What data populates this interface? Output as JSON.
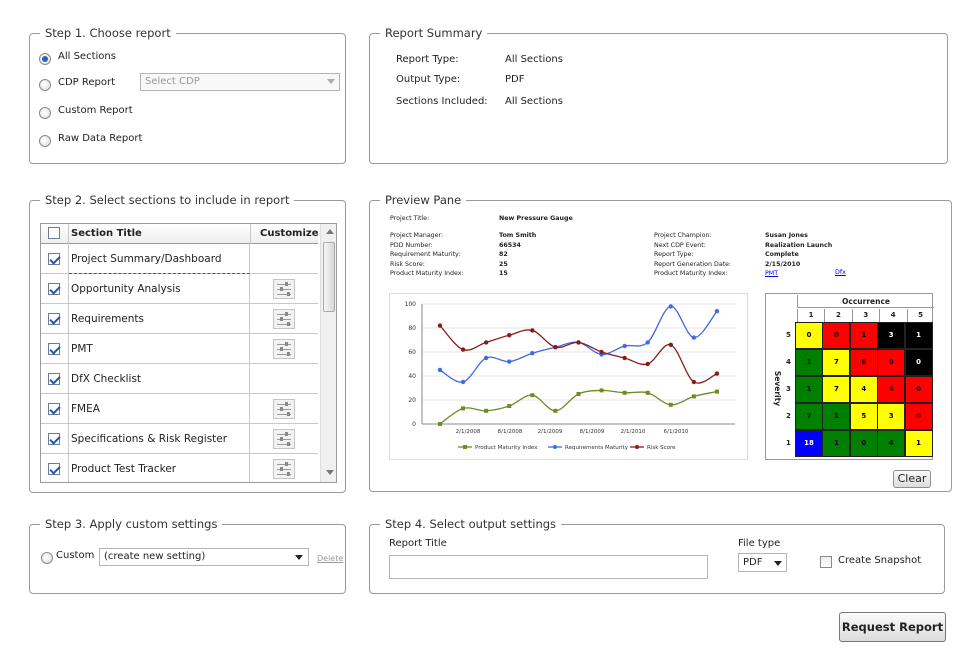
{
  "step1": {
    "legend": "Step 1. Choose report",
    "options": [
      {
        "label": "All Sections",
        "selected": true
      },
      {
        "label": "CDP Report",
        "selected": false
      },
      {
        "label": "Custom Report",
        "selected": false
      },
      {
        "label": "Raw Data Report",
        "selected": false
      }
    ],
    "cdp_placeholder": "Select CDP"
  },
  "summary": {
    "legend": "Report Summary",
    "rows": [
      {
        "label": "Report Type:",
        "value": "All Sections"
      },
      {
        "label": "Output Type:",
        "value": "PDF"
      },
      {
        "label": "Sections Included:",
        "value": "All Sections"
      }
    ]
  },
  "step2": {
    "legend": "Step 2. Select sections to include in report",
    "col_title": "Section Title",
    "col_customize": "Customize",
    "sections": [
      {
        "title": "Project Summary/Dashboard",
        "checked": true,
        "customizable": false
      },
      {
        "title": "Opportunity Analysis",
        "checked": true,
        "customizable": true
      },
      {
        "title": "Requirements",
        "checked": true,
        "customizable": true
      },
      {
        "title": "PMT",
        "checked": true,
        "customizable": true
      },
      {
        "title": "DfX Checklist",
        "checked": true,
        "customizable": false
      },
      {
        "title": "FMEA",
        "checked": true,
        "customizable": true
      },
      {
        "title": "Specifications & Risk Register",
        "checked": true,
        "customizable": true
      },
      {
        "title": "Product Test Tracker",
        "checked": true,
        "customizable": true
      }
    ]
  },
  "preview": {
    "legend": "Preview Pane",
    "project_title_label": "Project Title:",
    "project_title": "New Pressure Gauge",
    "left_rows": [
      {
        "label": "Project Manager:",
        "value": "Tom Smith"
      },
      {
        "label": "PDD Number:",
        "value": "66534"
      },
      {
        "label": "Requirement Maturity:",
        "value": "82"
      },
      {
        "label": "Risk Score:",
        "value": "25"
      },
      {
        "label": "Product Maturity Index:",
        "value": "15"
      }
    ],
    "right_rows": [
      {
        "label": "Project Champion:",
        "value": "Susan Jones"
      },
      {
        "label": "Next CDP Event:",
        "value": "Realization Launch"
      },
      {
        "label": "Report Type:",
        "value": "Complete"
      },
      {
        "label": "Report Generation Date:",
        "value": "2/15/2010"
      },
      {
        "label": "Product Maturity Index:",
        "value": "PMT",
        "link2": "Dfx"
      }
    ],
    "clear_label": "Clear",
    "heatmap": {
      "title": "Occurrence",
      "ylabel": "Severity",
      "col_labels": [
        "1",
        "2",
        "3",
        "4",
        "5"
      ],
      "row_labels": [
        "5",
        "4",
        "3",
        "2",
        "1"
      ],
      "cells": [
        [
          {
            "v": "0",
            "c": "#ffff00"
          },
          {
            "v": "0",
            "c": "#ff0000"
          },
          {
            "v": "1",
            "c": "#ff0000"
          },
          {
            "v": "3",
            "c": "#000000"
          },
          {
            "v": "1",
            "c": "#000000"
          }
        ],
        [
          {
            "v": "1",
            "c": "#008000"
          },
          {
            "v": "7",
            "c": "#ffff00"
          },
          {
            "v": "6",
            "c": "#ff0000"
          },
          {
            "v": "0",
            "c": "#ff0000"
          },
          {
            "v": "0",
            "c": "#000000"
          }
        ],
        [
          {
            "v": "1",
            "c": "#008000"
          },
          {
            "v": "7",
            "c": "#ffff00"
          },
          {
            "v": "4",
            "c": "#ffff00"
          },
          {
            "v": "4",
            "c": "#ff0000"
          },
          {
            "v": "0",
            "c": "#ff0000"
          }
        ],
        [
          {
            "v": "7",
            "c": "#008000"
          },
          {
            "v": "1",
            "c": "#008000"
          },
          {
            "v": "5",
            "c": "#ffff00"
          },
          {
            "v": "3",
            "c": "#ffff00"
          },
          {
            "v": "0",
            "c": "#ff0000"
          }
        ],
        [
          {
            "v": "18",
            "c": "#0000ff"
          },
          {
            "v": "1",
            "c": "#008000"
          },
          {
            "v": "0",
            "c": "#008000"
          },
          {
            "v": "4",
            "c": "#008000"
          },
          {
            "v": "1",
            "c": "#ffff00"
          }
        ]
      ]
    }
  },
  "chart_data": {
    "type": "line",
    "ylim": [
      0,
      100
    ],
    "yticks": [
      "0",
      "20",
      "40",
      "60",
      "80",
      "100"
    ],
    "xtick_labels": [
      "2/1/2008",
      "8/1/2008",
      "2/1/2009",
      "8/1/2009",
      "2/1/2010",
      "6/1/2010"
    ],
    "series": [
      {
        "name": "Product Maturity Index",
        "color": "#6b8e23",
        "marker": "square",
        "values": [
          0,
          13,
          11,
          15,
          24,
          11,
          25,
          28,
          26,
          26,
          16,
          23,
          27
        ]
      },
      {
        "name": "Requirements Maturity",
        "color": "#4169e1",
        "marker": "circle",
        "values": [
          45,
          35,
          55,
          52,
          59,
          64,
          68,
          58,
          65,
          68,
          98,
          72,
          94
        ]
      },
      {
        "name": "Risk Score",
        "color": "#8b1a1a",
        "marker": "circle",
        "values": [
          82,
          62,
          68,
          74,
          78,
          64,
          68,
          60,
          55,
          50,
          66,
          35,
          42
        ]
      }
    ]
  },
  "step3": {
    "legend": "Step 3. Apply custom settings",
    "radio_label": "Custom",
    "select_value": "(create new setting)",
    "delete_label": "Delete"
  },
  "step4": {
    "legend": "Step 4. Select output settings",
    "title_label": "Report Title",
    "title_value": "",
    "filetype_label": "File type",
    "filetype_value": "PDF",
    "snapshot_label": "Create Snapshot"
  },
  "request_label": "Request Report"
}
